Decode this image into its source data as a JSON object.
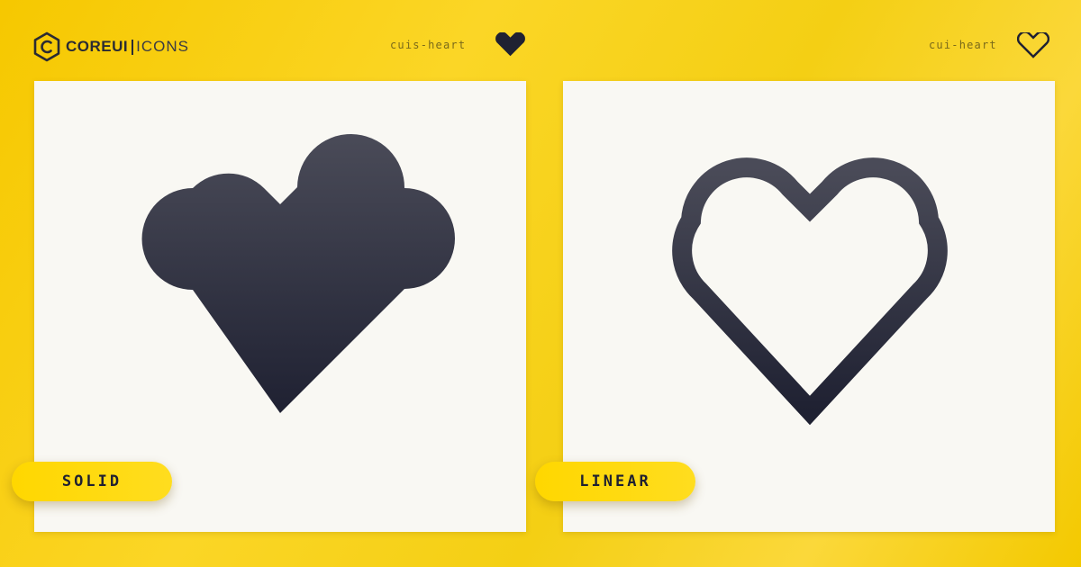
{
  "brand": {
    "strong": "COREUI",
    "light": "ICONS",
    "logo_icon": "hexagon-c-icon"
  },
  "variants": [
    {
      "icon_name": "cuis-heart",
      "label": "SOLID",
      "style": "solid",
      "icon": "heart-solid-icon"
    },
    {
      "icon_name": "cui-heart",
      "label": "LINEAR",
      "style": "linear",
      "icon": "heart-outline-icon"
    }
  ],
  "colors": {
    "background": "#f6c800",
    "card": "#f9f8f3",
    "icon_top": "#4a4b58",
    "icon_bottom": "#1f2132",
    "pill": "#ffd700",
    "text_dark": "#1f2030"
  }
}
